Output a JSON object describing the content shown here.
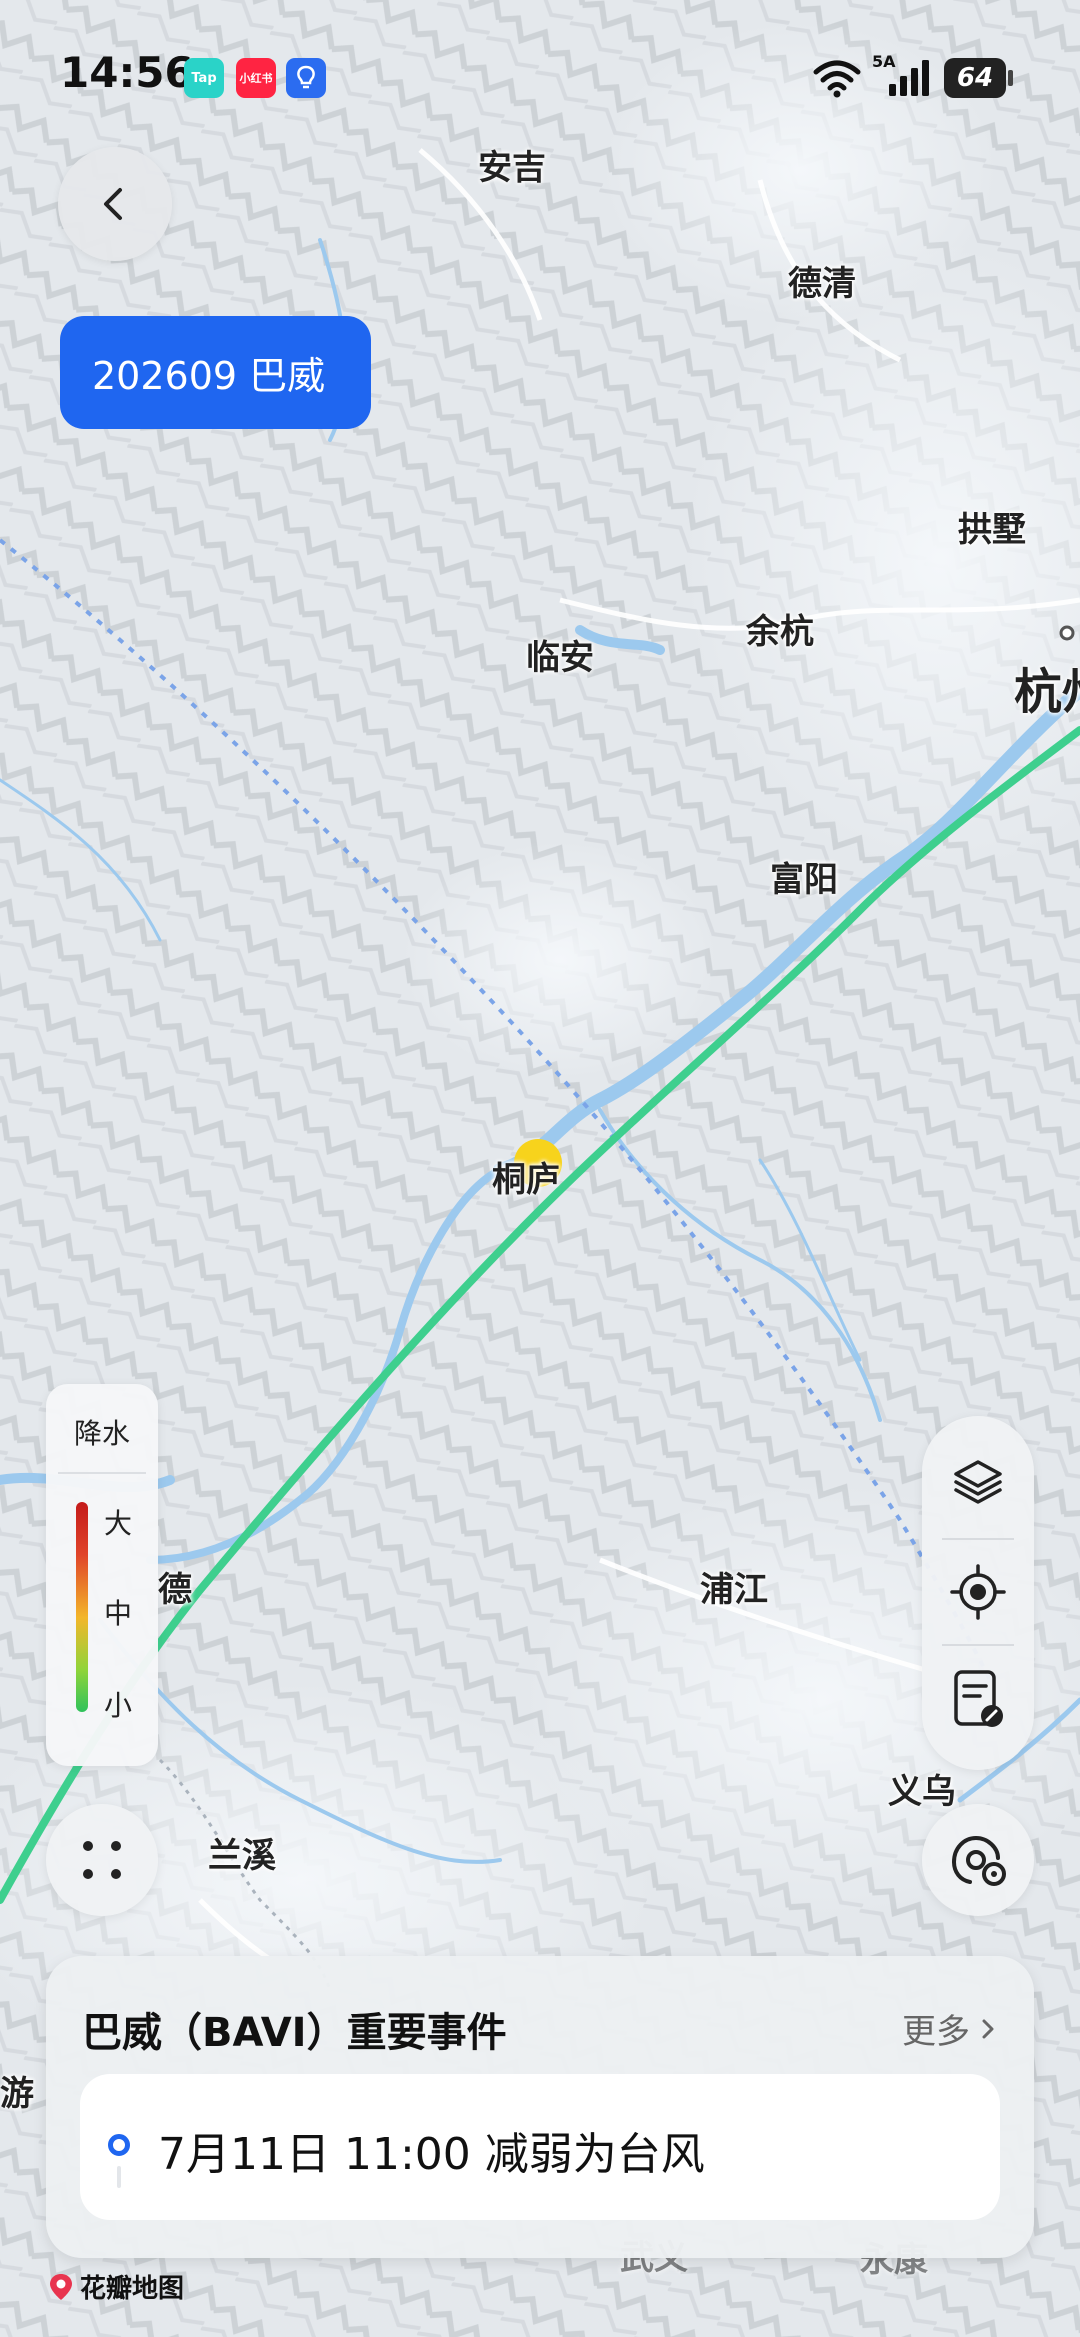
{
  "status_bar": {
    "time": "14:56",
    "network": "5A",
    "battery": "64",
    "notification_apps": [
      {
        "icon": "taptap-icon",
        "label": "Tap",
        "color": "#2ad3c8"
      },
      {
        "icon": "xiaohongshu-icon",
        "label": "小红书",
        "color": "#ff2442"
      },
      {
        "icon": "lightbulb-app-icon",
        "label": "",
        "color": "#2b6cf0"
      }
    ]
  },
  "typhoon": {
    "tag_label": "202609 巴威"
  },
  "map": {
    "cities": [
      {
        "name": "安吉"
      },
      {
        "name": "德清"
      },
      {
        "name": "拱墅"
      },
      {
        "name": "余杭"
      },
      {
        "name": "临安"
      },
      {
        "name": "杭州"
      },
      {
        "name": "富阳"
      },
      {
        "name": "桐庐"
      },
      {
        "name": "德"
      },
      {
        "name": "浦江"
      },
      {
        "name": "义乌"
      },
      {
        "name": "兰溪"
      },
      {
        "name": "游"
      },
      {
        "name": "武义"
      },
      {
        "name": "永康"
      }
    ],
    "track_color": "#3ecf8e",
    "marker_color": "#f7d31c"
  },
  "legend": {
    "title": "降水",
    "high": "大",
    "mid": "中",
    "low": "小"
  },
  "event_card": {
    "title": "巴威（BAVI）重要事件",
    "more": "更多",
    "items": [
      {
        "text": "7月11日 11:00 减弱为台风"
      }
    ]
  },
  "attribution": "花瓣地图",
  "colors": {
    "accent": "#1f66f0",
    "track": "#3ecf8e"
  }
}
